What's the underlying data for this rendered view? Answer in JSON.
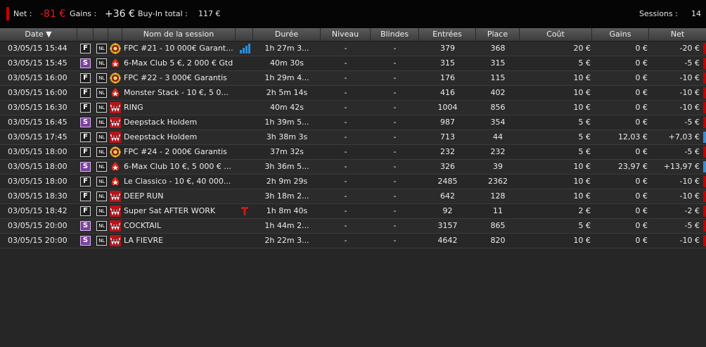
{
  "summary": {
    "net_label": "Net :",
    "net_value": "-81 €",
    "gains_label": "Gains :",
    "gains_value": "+36 €",
    "buyin_label": "Buy-In total :",
    "buyin_value": "117 €",
    "sessions_label": "Sessions :",
    "sessions_value": "14"
  },
  "colors": {
    "negative": "#c80000",
    "positive": "#3a8fd6",
    "satellite_badge": "#7b3fa0"
  },
  "columns": [
    {
      "key": "date",
      "label": "Date ▼"
    },
    {
      "key": "type",
      "label": ""
    },
    {
      "key": "game",
      "label": ""
    },
    {
      "key": "room",
      "label": ""
    },
    {
      "key": "name",
      "label": "Nom de la session"
    },
    {
      "key": "extra",
      "label": ""
    },
    {
      "key": "duree",
      "label": "Durée"
    },
    {
      "key": "niveau",
      "label": "Niveau"
    },
    {
      "key": "blindes",
      "label": "Blindes"
    },
    {
      "key": "entrees",
      "label": "Entrées"
    },
    {
      "key": "place",
      "label": "Place"
    },
    {
      "key": "cout",
      "label": "Coût"
    },
    {
      "key": "gains",
      "label": "Gains"
    },
    {
      "key": "net",
      "label": "Net"
    }
  ],
  "rows": [
    {
      "date": "03/05/15 15:44",
      "type": "F",
      "game": "NL",
      "room": "fpc-icon",
      "name": "FPC #21 - 10 000€ Garant...",
      "extra": "bars-icon",
      "duree": "1h 27m 3...",
      "niveau": "-",
      "blindes": "-",
      "entrees": "379",
      "place": "368",
      "cout": "20 €",
      "gains": "0 €",
      "net": "-20 €",
      "sign": "neg"
    },
    {
      "date": "03/05/15 15:45",
      "type": "S",
      "game": "NL",
      "room": "stars-icon",
      "name": "6-Max Club 5 €, 2 000 € Gtd",
      "extra": "",
      "duree": "40m 30s",
      "niveau": "-",
      "blindes": "-",
      "entrees": "315",
      "place": "315",
      "cout": "5 €",
      "gains": "0 €",
      "net": "-5 €",
      "sign": "neg"
    },
    {
      "date": "03/05/15 16:00",
      "type": "F",
      "game": "NL",
      "room": "fpc-icon",
      "name": "FPC #22 - 3 000€ Garantis",
      "extra": "",
      "duree": "1h 29m 4...",
      "niveau": "-",
      "blindes": "-",
      "entrees": "176",
      "place": "115",
      "cout": "10 €",
      "gains": "0 €",
      "net": "-10 €",
      "sign": "neg"
    },
    {
      "date": "03/05/15 16:00",
      "type": "F",
      "game": "NL",
      "room": "stars-icon",
      "name": "Monster Stack - 10 €, 5 0...",
      "extra": "",
      "duree": "2h 5m 14s",
      "niveau": "-",
      "blindes": "-",
      "entrees": "416",
      "place": "402",
      "cout": "10 €",
      "gains": "0 €",
      "net": "-10 €",
      "sign": "neg"
    },
    {
      "date": "03/05/15 16:30",
      "type": "F",
      "game": "NL",
      "room": "winamax-icon",
      "name": "RING",
      "extra": "",
      "duree": "40m 42s",
      "niveau": "-",
      "blindes": "-",
      "entrees": "1004",
      "place": "856",
      "cout": "10 €",
      "gains": "0 €",
      "net": "-10 €",
      "sign": "neg"
    },
    {
      "date": "03/05/15 16:45",
      "type": "S",
      "game": "NL",
      "room": "winamax-icon",
      "name": "Deepstack Holdem",
      "extra": "",
      "duree": "1h 39m 5...",
      "niveau": "-",
      "blindes": "-",
      "entrees": "987",
      "place": "354",
      "cout": "5 €",
      "gains": "0 €",
      "net": "-5 €",
      "sign": "neg"
    },
    {
      "date": "03/05/15 17:45",
      "type": "F",
      "game": "NL",
      "room": "winamax-icon",
      "name": "Deepstack Holdem",
      "extra": "",
      "duree": "3h 38m 3s",
      "niveau": "-",
      "blindes": "-",
      "entrees": "713",
      "place": "44",
      "cout": "5 €",
      "gains": "12,03 €",
      "net": "+7,03 €",
      "sign": "pos"
    },
    {
      "date": "03/05/15 18:00",
      "type": "F",
      "game": "NL",
      "room": "fpc-icon",
      "name": "FPC #24 - 2 000€ Garantis",
      "extra": "",
      "duree": "37m 32s",
      "niveau": "-",
      "blindes": "-",
      "entrees": "232",
      "place": "232",
      "cout": "5 €",
      "gains": "0 €",
      "net": "-5 €",
      "sign": "neg"
    },
    {
      "date": "03/05/15 18:00",
      "type": "S",
      "game": "NL",
      "room": "stars-icon",
      "name": "6-Max Club 10 €, 5 000 € ...",
      "extra": "",
      "duree": "3h 36m 5...",
      "niveau": "-",
      "blindes": "-",
      "entrees": "326",
      "place": "39",
      "cout": "10 €",
      "gains": "23,97 €",
      "net": "+13,97 €",
      "sign": "pos"
    },
    {
      "date": "03/05/15 18:00",
      "type": "F",
      "game": "NL",
      "room": "stars-icon",
      "name": "Le Classico - 10 €, 40 000...",
      "extra": "",
      "duree": "2h 9m 29s",
      "niveau": "-",
      "blindes": "-",
      "entrees": "2485",
      "place": "2362",
      "cout": "10 €",
      "gains": "0 €",
      "net": "-10 €",
      "sign": "neg"
    },
    {
      "date": "03/05/15 18:30",
      "type": "F",
      "game": "NL",
      "room": "winamax-icon",
      "name": "DEEP RUN",
      "extra": "",
      "duree": "3h 18m 2...",
      "niveau": "-",
      "blindes": "-",
      "entrees": "642",
      "place": "128",
      "cout": "10 €",
      "gains": "0 €",
      "net": "-10 €",
      "sign": "neg"
    },
    {
      "date": "03/05/15 18:42",
      "type": "F",
      "game": "NL",
      "room": "winamax-icon",
      "name": "Super Sat AFTER WORK",
      "extra": "ticket-icon",
      "duree": "1h 8m 40s",
      "niveau": "-",
      "blindes": "-",
      "entrees": "92",
      "place": "11",
      "cout": "2 €",
      "gains": "0 €",
      "net": "-2 €",
      "sign": "neg"
    },
    {
      "date": "03/05/15 20:00",
      "type": "S",
      "game": "NL",
      "room": "winamax-icon",
      "name": "COCKTAIL",
      "extra": "",
      "duree": "1h 44m 2...",
      "niveau": "-",
      "blindes": "-",
      "entrees": "3157",
      "place": "865",
      "cout": "5 €",
      "gains": "0 €",
      "net": "-5 €",
      "sign": "neg"
    },
    {
      "date": "03/05/15 20:00",
      "type": "S",
      "game": "NL",
      "room": "winamax-icon",
      "name": "LA FIEVRE",
      "extra": "",
      "duree": "2h 22m 3...",
      "niveau": "-",
      "blindes": "-",
      "entrees": "4642",
      "place": "820",
      "cout": "10 €",
      "gains": "0 €",
      "net": "-10 €",
      "sign": "neg"
    }
  ]
}
